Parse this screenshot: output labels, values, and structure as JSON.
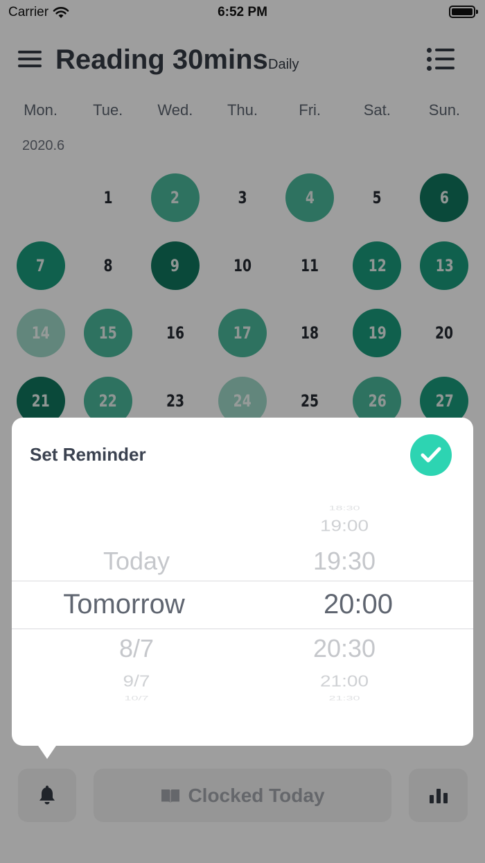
{
  "status_bar": {
    "carrier": "Carrier",
    "time": "6:52 PM"
  },
  "header": {
    "title": "Reading 30mins",
    "subtitle": "Daily"
  },
  "weekdays": [
    "Mon.",
    "Tue.",
    "Wed.",
    "Thu.",
    "Fri.",
    "Sat.",
    "Sun."
  ],
  "calendar": {
    "month_label": "2020.6",
    "days": [
      {
        "label": "",
        "level": "none"
      },
      {
        "label": "1",
        "level": "none"
      },
      {
        "label": "2",
        "level": "light"
      },
      {
        "label": "3",
        "level": "none"
      },
      {
        "label": "4",
        "level": "light"
      },
      {
        "label": "5",
        "level": "none"
      },
      {
        "label": "6",
        "level": "dark"
      },
      {
        "label": "7",
        "level": "mid"
      },
      {
        "label": "8",
        "level": "none"
      },
      {
        "label": "9",
        "level": "dark"
      },
      {
        "label": "10",
        "level": "none"
      },
      {
        "label": "11",
        "level": "none"
      },
      {
        "label": "12",
        "level": "mid"
      },
      {
        "label": "13",
        "level": "mid"
      },
      {
        "label": "14",
        "level": "pale"
      },
      {
        "label": "15",
        "level": "light"
      },
      {
        "label": "16",
        "level": "none"
      },
      {
        "label": "17",
        "level": "light"
      },
      {
        "label": "18",
        "level": "none"
      },
      {
        "label": "19",
        "level": "mid"
      },
      {
        "label": "20",
        "level": "none"
      },
      {
        "label": "21",
        "level": "dark"
      },
      {
        "label": "22",
        "level": "light"
      },
      {
        "label": "23",
        "level": "none"
      },
      {
        "label": "24",
        "level": "pale"
      },
      {
        "label": "25",
        "level": "none"
      },
      {
        "label": "26",
        "level": "light"
      },
      {
        "label": "27",
        "level": "mid"
      }
    ]
  },
  "reminder": {
    "title": "Set Reminder",
    "date_options": {
      "above_1": "Today",
      "selected": "Tomorrow",
      "below_1": "8/7",
      "below_2": "9/7",
      "below_3": "10/7"
    },
    "time_options": {
      "above_3": "18:30",
      "above_2": "19:00",
      "above_1": "19:30",
      "selected": "20:00",
      "below_1": "20:30",
      "below_2": "21:00",
      "below_3": "21:30"
    }
  },
  "toolbar": {
    "clock_label": "Clocked Today"
  },
  "icons": [
    "wifi-icon",
    "battery-icon",
    "menu-icon",
    "list-icon",
    "check-icon",
    "bell-icon",
    "book-icon",
    "bar-chart-icon"
  ],
  "colors": {
    "accent": "#2dd4b2",
    "dark_green": "#11775e",
    "mid_green": "#1a9c7c",
    "light_green": "#4bb89b",
    "pale_green": "#9fd8c8"
  }
}
